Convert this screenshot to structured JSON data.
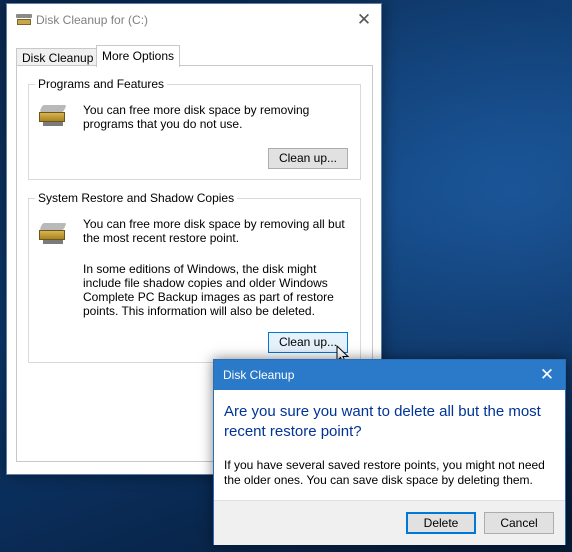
{
  "main_window": {
    "title": "Disk Cleanup for  (C:)",
    "close_glyph": "✕",
    "tabs": [
      {
        "label": "Disk Cleanup",
        "active": false
      },
      {
        "label": "More Options",
        "active": true
      }
    ],
    "programs": {
      "title": "Programs and Features",
      "icon": "disk-cleanup-drive-icon",
      "text": "You can free more disk space by removing programs that you do not use.",
      "button": "Clean up..."
    },
    "restore": {
      "title": "System Restore and Shadow Copies",
      "icon": "disk-cleanup-drive-icon",
      "text": "You can free more disk space by removing all but the most recent restore point.",
      "text2": "In some editions of Windows, the disk might include file shadow copies and older Windows Complete PC Backup images as part of restore points. This information will also be deleted.",
      "button": "Clean up..."
    }
  },
  "dialog": {
    "title": "Disk Cleanup",
    "close_glyph": "✕",
    "main_instruction": "Are you sure you want to delete all but the most recent restore point?",
    "body": "If you have several saved restore points, you might not need the older ones. You can save disk space by deleting them.",
    "delete_button": "Delete",
    "cancel_button": "Cancel"
  },
  "colors": {
    "dialog_titlebar": "#2b79c9",
    "main_instruction": "#003399",
    "focus_border": "#0078d7"
  }
}
